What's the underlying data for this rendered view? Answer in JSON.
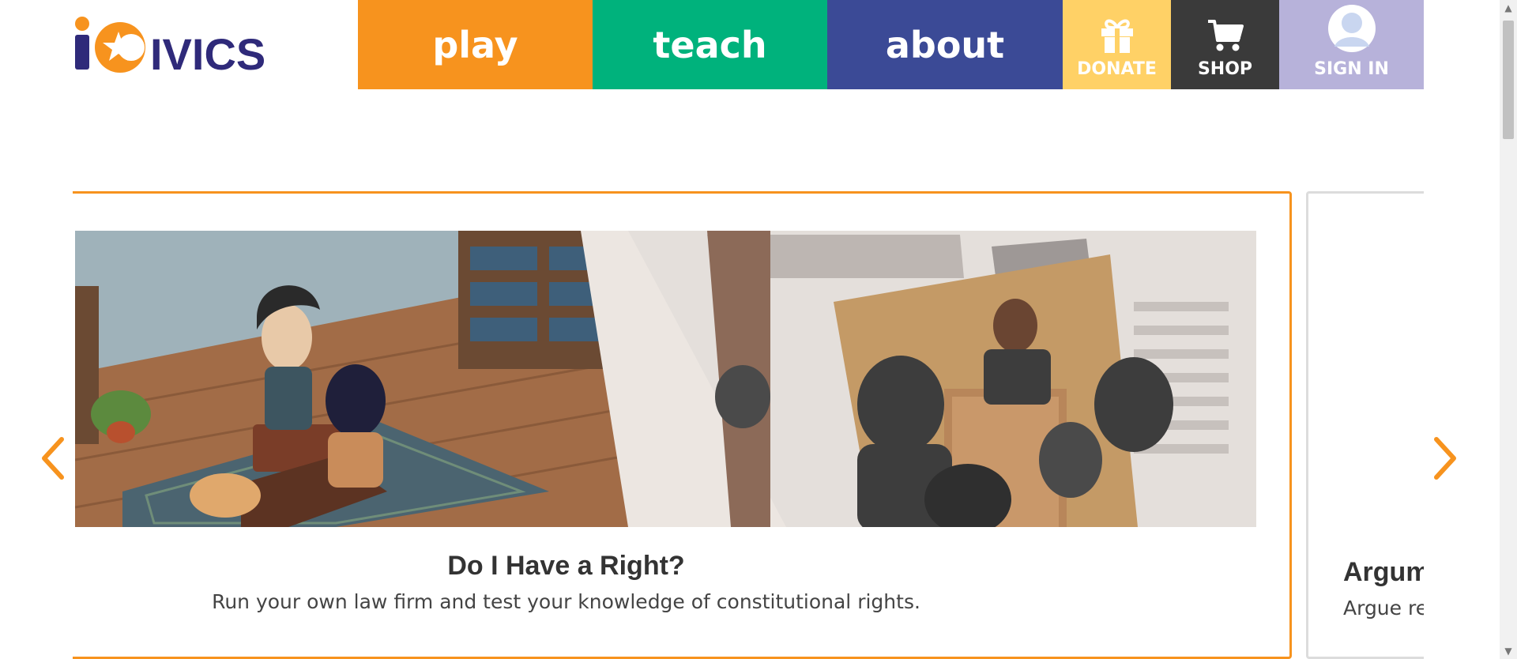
{
  "logo": {
    "alt": "iCivics"
  },
  "nav": {
    "play": "play",
    "teach": "teach",
    "about": "about",
    "donate": "DONATE",
    "shop": "SHOP",
    "sign_in": "SIGN IN"
  },
  "colors": {
    "play": "#f7931e",
    "teach": "#00b27c",
    "about": "#3b4a96",
    "donate": "#ffd166",
    "shop": "#3a3a3a",
    "sign_in": "#b7b2da",
    "logo": "#2f2a7a"
  },
  "carousel": {
    "current": {
      "title": "Do I Have a Right?",
      "description": "Run your own law firm and test your knowledge of constitutional rights."
    },
    "next": {
      "title": "Argum",
      "description": "Argue re"
    }
  },
  "icons": {
    "donate": "gift-icon",
    "shop": "cart-icon",
    "sign_in": "avatar-icon",
    "prev": "chevron-left-icon",
    "next": "chevron-right-icon"
  }
}
